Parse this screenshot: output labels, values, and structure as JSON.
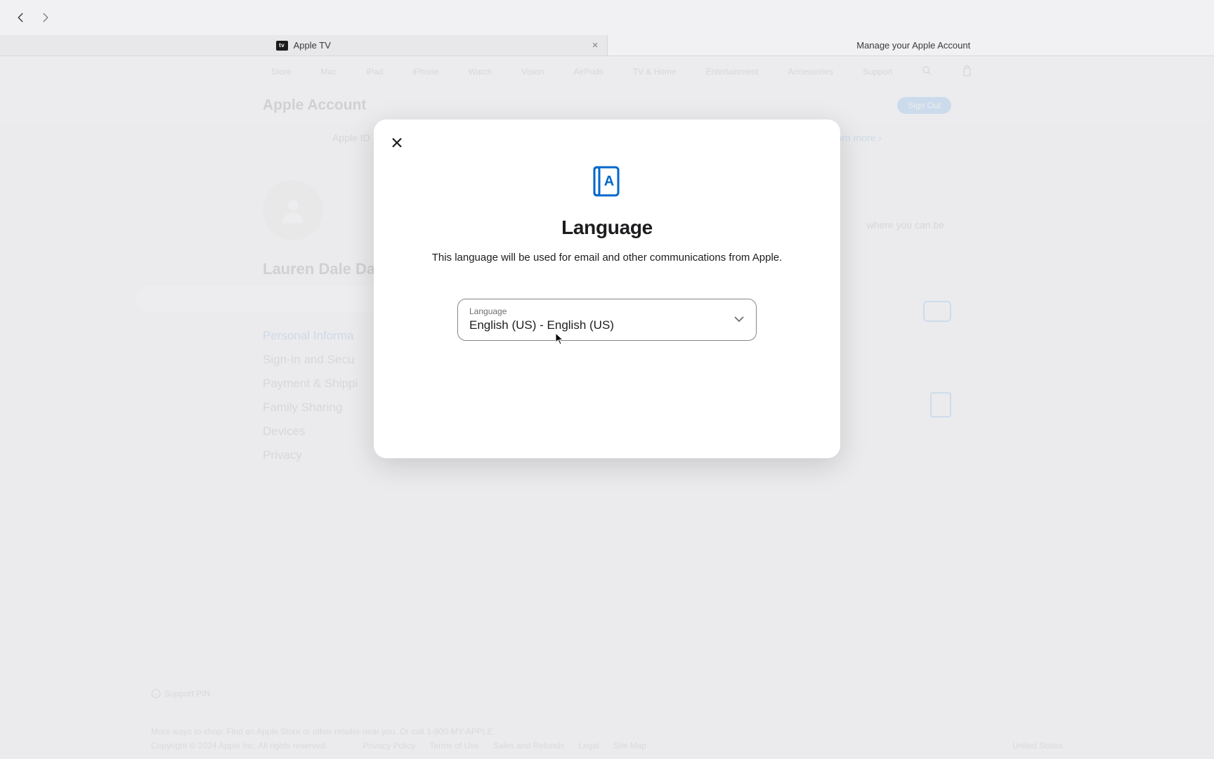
{
  "browser": {
    "tabs": [
      {
        "label": "Apple TV",
        "icon": "tv"
      },
      {
        "label": "Manage your Apple Account",
        "icon": "apple"
      }
    ]
  },
  "apple_nav": {
    "items": [
      "Store",
      "Mac",
      "iPad",
      "iPhone",
      "Watch",
      "Vision",
      "AirPods",
      "TV & Home",
      "Entertainment",
      "Accessories",
      "Support"
    ]
  },
  "sub_header": {
    "title": "Apple Account",
    "sign_out": "Sign Out"
  },
  "notice": {
    "prefix": "Apple ID",
    "link": "Learn more ›"
  },
  "sidebar": {
    "user_name": "Lauren Dale Dal",
    "links": [
      {
        "label": "Personal Informa",
        "active": true
      },
      {
        "label": "Sign-In and Secu",
        "active": false
      },
      {
        "label": "Payment & Shippi",
        "active": false
      },
      {
        "label": "Family Sharing",
        "active": false
      },
      {
        "label": "Devices",
        "active": false
      },
      {
        "label": "Privacy",
        "active": false
      }
    ]
  },
  "main": {
    "panel_text": "where you can be"
  },
  "footer": {
    "support_pin": "Support PIN",
    "shop": "More ways to shop: Find an Apple Store or other retailer near you. Or call 1-800-MY-APPLE.",
    "copyright": "Copyright © 2024 Apple Inc. All rights reserved.",
    "legal": [
      "Privacy Policy",
      "Terms of Use",
      "Sales and Refunds",
      "Legal",
      "Site Map"
    ],
    "country": "United States"
  },
  "modal": {
    "title": "Language",
    "description": "This language will be used for email and other communications from Apple.",
    "select_label": "Language",
    "select_value": "English (US) - English (US)"
  }
}
